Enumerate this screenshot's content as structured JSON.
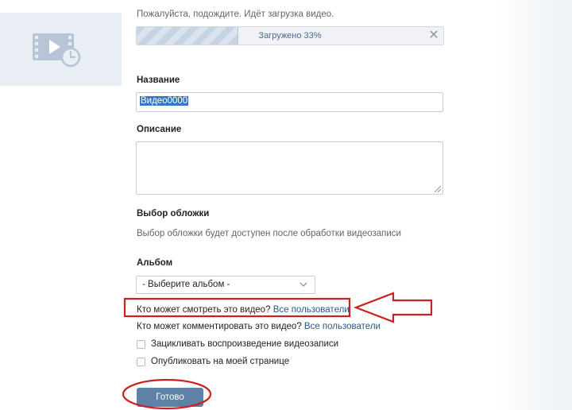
{
  "upload": {
    "status_text": "Пожалуйста, подождите. Идёт загрузка видео.",
    "progress_label": "Загружено 33%",
    "progress_fraction": 0.33
  },
  "thumbnail": {
    "icon": "video-clock-icon"
  },
  "form": {
    "name_label": "Название",
    "name_value": "Видео0000",
    "description_label": "Описание",
    "description_value": "",
    "cover_label": "Выбор обложки",
    "cover_hint": "Выбор обложки будет доступен после обработки видеозаписи",
    "album_label": "Альбом",
    "album_selected": "- Выберите альбом -"
  },
  "privacy": {
    "view_question": "Кто может смотреть это видео?",
    "view_value": "Все пользователи",
    "comment_question": "Кто может комментировать это видео?",
    "comment_value": "Все пользователи"
  },
  "options": {
    "loop_label": "Зацикливать воспроизведение видеозаписи",
    "publish_label": "Опубликовать на моей странице"
  },
  "actions": {
    "done_label": "Готово"
  },
  "colors": {
    "accent": "#5e81a8",
    "link": "#2a5885",
    "annotation": "#cc1f1f"
  }
}
